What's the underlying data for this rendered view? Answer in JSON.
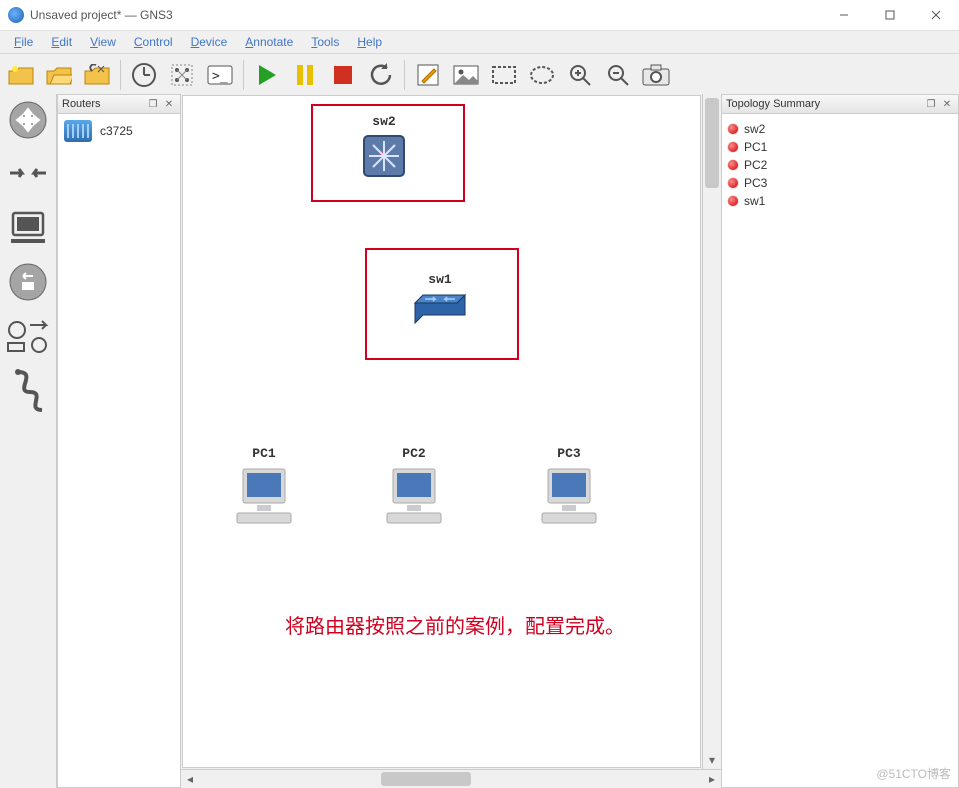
{
  "window": {
    "title": "Unsaved project* — GNS3"
  },
  "menu": {
    "file": "File",
    "edit": "Edit",
    "view": "View",
    "control": "Control",
    "device": "Device",
    "annotate": "Annotate",
    "tools": "Tools",
    "help": "Help"
  },
  "routers_panel": {
    "title": "Routers",
    "item": "c3725"
  },
  "topology_panel": {
    "title": "Topology Summary",
    "items": [
      "sw2",
      "PC1",
      "PC2",
      "PC3",
      "sw1"
    ]
  },
  "canvas": {
    "nodes": {
      "sw2": "sw2",
      "sw1": "sw1",
      "pc1": "PC1",
      "pc2": "PC2",
      "pc3": "PC3"
    },
    "annotation": "将路由器按照之前的案例，配置完成。"
  },
  "watermark": "@51CTO博客"
}
